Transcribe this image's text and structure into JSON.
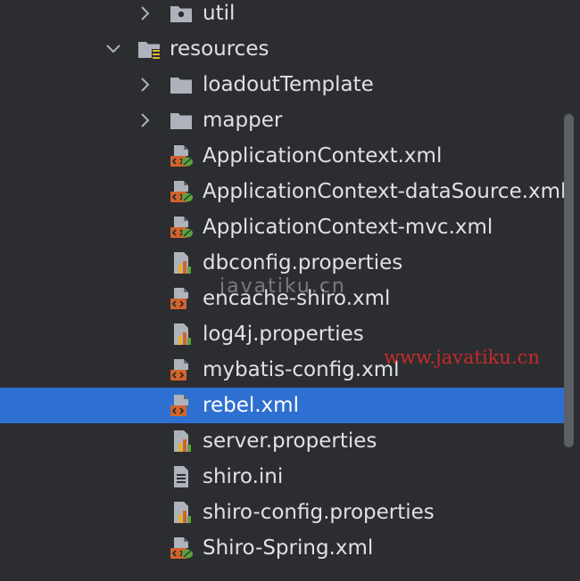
{
  "tree": {
    "rows": [
      {
        "label": "util",
        "kind": "folder-package",
        "expand": "collapsed",
        "selected": false
      },
      {
        "label": "resources",
        "kind": "folder-resources",
        "expand": "expanded",
        "selected": false
      },
      {
        "label": "loadoutTemplate",
        "kind": "folder",
        "expand": "collapsed",
        "selected": false
      },
      {
        "label": "mapper",
        "kind": "folder",
        "expand": "collapsed",
        "selected": false
      },
      {
        "label": "ApplicationContext.xml",
        "kind": "spring-xml",
        "expand": "none",
        "selected": false
      },
      {
        "label": "ApplicationContext-dataSource.xml",
        "kind": "spring-xml",
        "expand": "none",
        "selected": false
      },
      {
        "label": "ApplicationContext-mvc.xml",
        "kind": "spring-xml",
        "expand": "none",
        "selected": false
      },
      {
        "label": "dbconfig.properties",
        "kind": "properties",
        "expand": "none",
        "selected": false
      },
      {
        "label": "encache-shiro.xml",
        "kind": "xml",
        "expand": "none",
        "selected": false
      },
      {
        "label": "log4j.properties",
        "kind": "properties",
        "expand": "none",
        "selected": false
      },
      {
        "label": "mybatis-config.xml",
        "kind": "xml",
        "expand": "none",
        "selected": false
      },
      {
        "label": "rebel.xml",
        "kind": "xml",
        "expand": "none",
        "selected": true
      },
      {
        "label": "server.properties",
        "kind": "properties",
        "expand": "none",
        "selected": false
      },
      {
        "label": "shiro.ini",
        "kind": "text",
        "expand": "none",
        "selected": false
      },
      {
        "label": "shiro-config.properties",
        "kind": "properties",
        "expand": "none",
        "selected": false
      },
      {
        "label": "Shiro-Spring.xml",
        "kind": "spring-xml",
        "expand": "none",
        "selected": false
      }
    ]
  },
  "watermarks": {
    "gray": "javatiku.cn",
    "red": "www.javatiku.cn"
  },
  "colors": {
    "background": "#2b2d30",
    "selection": "#2e70d1",
    "text": "#dfe1e5",
    "folder": "#aeb3bb",
    "xml_badge": "#d2642b",
    "spring_leaf": "#5ca33d",
    "watermark_red": "#c42a2a"
  }
}
